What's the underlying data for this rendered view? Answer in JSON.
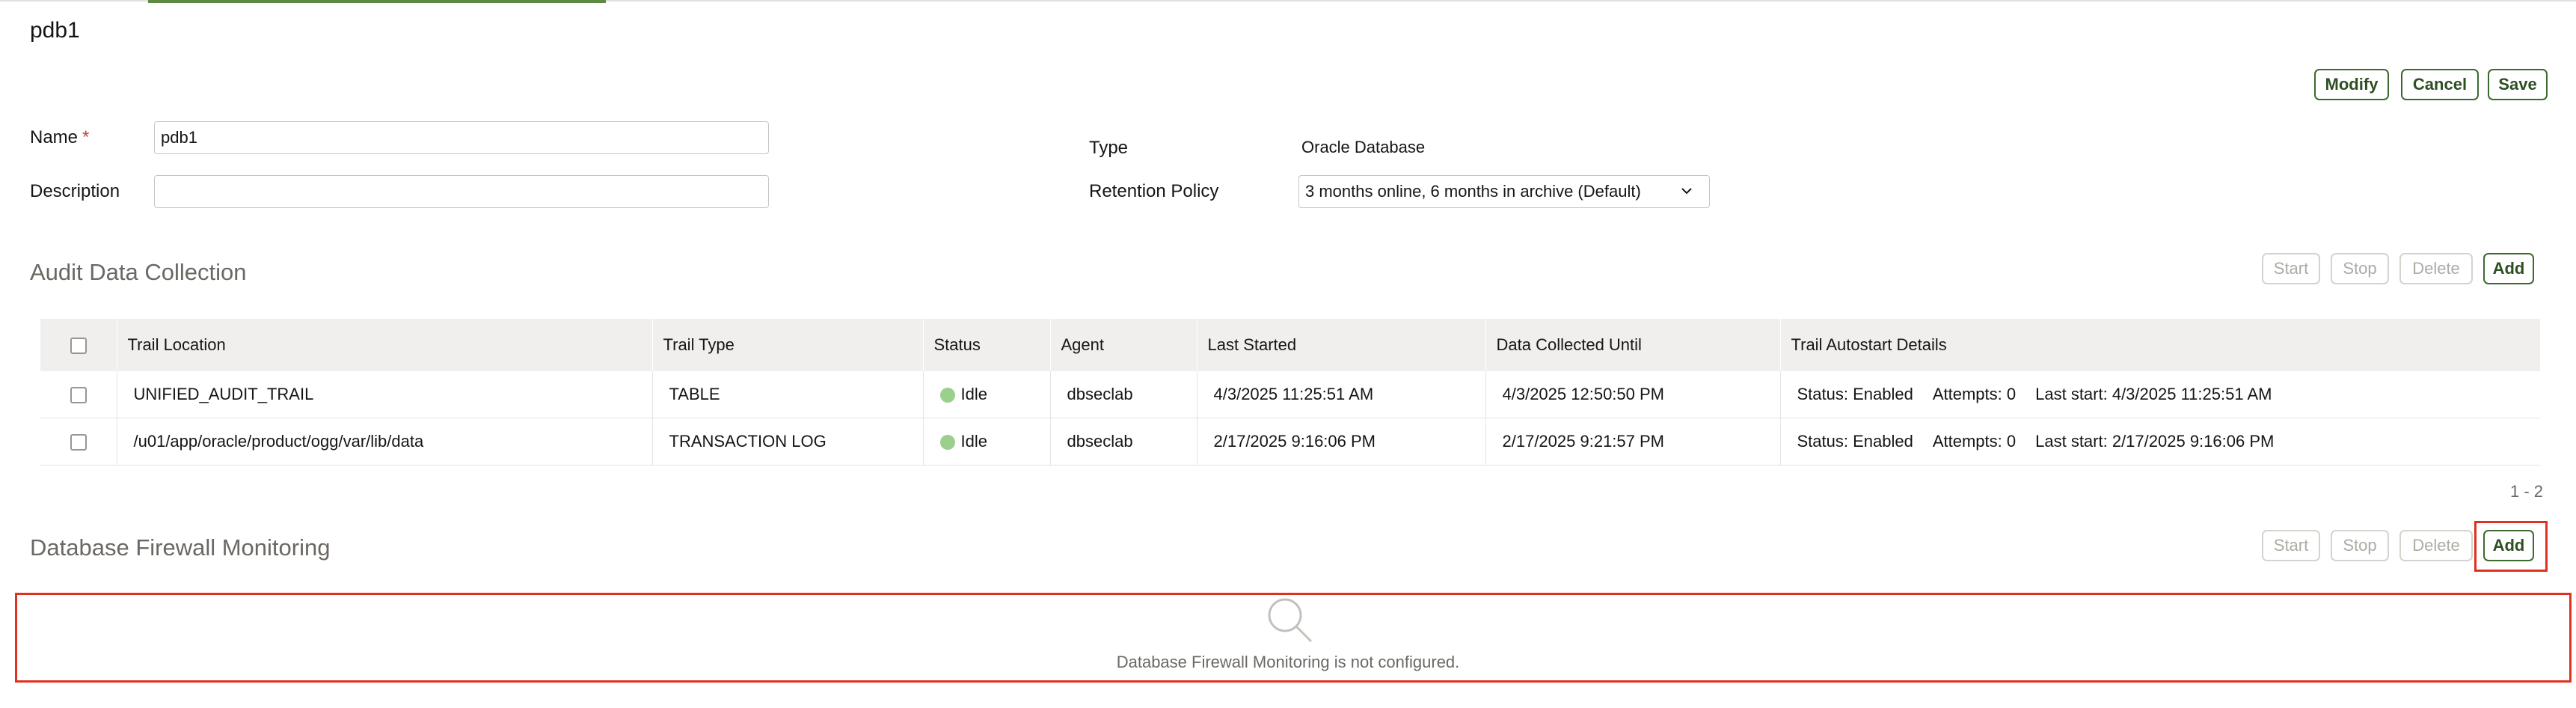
{
  "page": {
    "title": "pdb1"
  },
  "actions": {
    "modify": "Modify",
    "cancel": "Cancel",
    "save": "Save"
  },
  "form": {
    "name_label": "Name",
    "required_mark": "*",
    "name_value": "pdb1",
    "description_label": "Description",
    "description_value": "",
    "type_label": "Type",
    "type_value": "Oracle Database",
    "retention_label": "Retention Policy",
    "retention_value": "3 months online, 6 months in archive (Default)"
  },
  "audit_collection": {
    "title": "Audit Data Collection",
    "buttons": {
      "start": "Start",
      "stop": "Stop",
      "delete": "Delete",
      "add": "Add"
    },
    "columns": [
      "Trail Location",
      "Trail Type",
      "Status",
      "Agent",
      "Last Started",
      "Data Collected Until",
      "Trail Autostart Details"
    ],
    "rows": [
      {
        "location": "UNIFIED_AUDIT_TRAIL",
        "type": "TABLE",
        "status": "Idle",
        "agent": "dbseclab",
        "last_started": "4/3/2025 11:25:51 AM",
        "collected_until": "4/3/2025 12:50:50 PM",
        "autostart_status": "Status: Enabled",
        "autostart_attempts": "Attempts: 0",
        "autostart_last": "Last start: 4/3/2025 11:25:51 AM"
      },
      {
        "location": "/u01/app/oracle/product/ogg/var/lib/data",
        "type": "TRANSACTION LOG",
        "status": "Idle",
        "agent": "dbseclab",
        "last_started": "2/17/2025 9:16:06 PM",
        "collected_until": "2/17/2025 9:21:57 PM",
        "autostart_status": "Status: Enabled",
        "autostart_attempts": "Attempts: 0",
        "autostart_last": "Last start: 2/17/2025 9:16:06 PM"
      }
    ],
    "pager": "1 - 2"
  },
  "firewall": {
    "title": "Database Firewall Monitoring",
    "buttons": {
      "start": "Start",
      "stop": "Stop",
      "delete": "Delete",
      "add": "Add"
    },
    "empty_message": "Database Firewall Monitoring is not configured."
  },
  "colors": {
    "accent": "#5f8a43",
    "button_border": "#3c6a2e",
    "highlight": "#e0311f",
    "status_idle": "#9bcf8c"
  },
  "icons": {
    "empty_state": "search-icon",
    "dropdown": "chevron-down-icon"
  }
}
